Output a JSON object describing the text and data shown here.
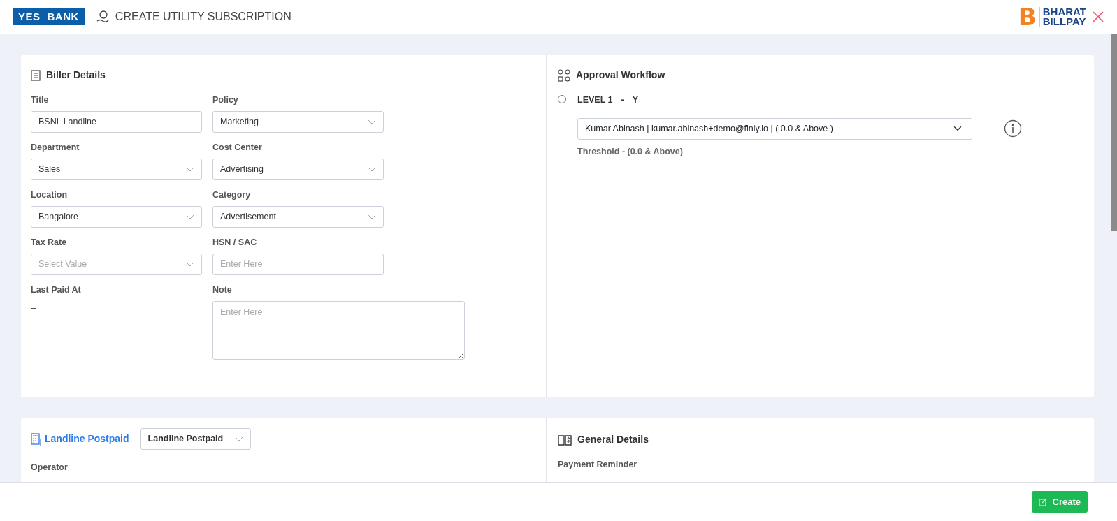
{
  "header": {
    "title": "CREATE UTILITY SUBSCRIPTION",
    "bank_logo": {
      "left": "YES",
      "right": "BANK"
    },
    "partner_logo": {
      "mark": "B",
      "line1": "BHARAT",
      "line2": "BILLPAY"
    }
  },
  "biller_details": {
    "title": "Biller Details",
    "fields": [
      {
        "label": "Title",
        "kind": "input",
        "value": "BSNL Landline"
      },
      {
        "label": "Policy",
        "kind": "select",
        "value": "Marketing"
      },
      {
        "label": "Department",
        "kind": "select",
        "value": "Sales"
      },
      {
        "label": "Cost Center",
        "kind": "select",
        "value": "Advertising"
      },
      {
        "label": "Location",
        "kind": "select",
        "value": "Bangalore"
      },
      {
        "label": "Category",
        "kind": "select",
        "value": "Advertisement"
      },
      {
        "label": "Tax Rate",
        "kind": "select",
        "placeholder": "Select Value"
      },
      {
        "label": "HSN / SAC",
        "kind": "input",
        "placeholder": "Enter Here"
      },
      {
        "label": "Last Paid At",
        "kind": "static",
        "value": "--"
      },
      {
        "label": "Note",
        "kind": "textarea",
        "placeholder": "Enter Here"
      }
    ]
  },
  "approval_workflow": {
    "title": "Approval Workflow",
    "levels": [
      {
        "name": "LEVEL 1",
        "separator": "-",
        "flag": "Y",
        "selected": false,
        "approver": "Kumar Abinash | kumar.abinash+demo@finly.io | ( 0.0 & Above )",
        "threshold": "Threshold -  (0.0  & Above)"
      }
    ]
  },
  "service": {
    "title": "Landline Postpaid",
    "dropdown": "Landline Postpaid",
    "fields": [
      {
        "label": "Operator"
      }
    ]
  },
  "general_details": {
    "title": "General Details",
    "fields": [
      {
        "label": "Payment Reminder"
      }
    ]
  },
  "footer": {
    "buttons": [
      {
        "label": "Create"
      }
    ]
  }
}
